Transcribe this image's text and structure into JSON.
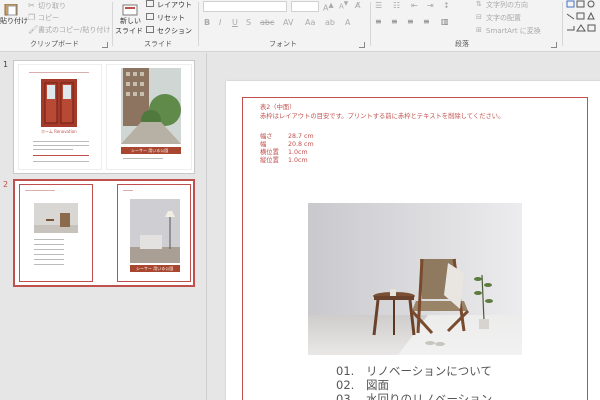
{
  "ribbon": {
    "clipboard": {
      "paste_label": "貼り付け",
      "cut_label": "切り取り",
      "copy_label": "コピー",
      "format_painter_label": "書式のコピー/貼り付け",
      "group_label": "クリップボード"
    },
    "slides": {
      "new_slide_label": "新しい",
      "new_slide_label2": "スライド",
      "layout_label": "レイアウト",
      "reset_label": "リセット",
      "section_label": "セクション",
      "group_label": "スライド"
    },
    "font": {
      "group_label": "フォント"
    },
    "paragraph": {
      "text_direction_label": "文字列の方向",
      "align_text_label": "文字の配置",
      "smartart_label": "SmartArt に変換",
      "group_label": "段落"
    }
  },
  "thumbnails": {
    "slide1_num": "1",
    "slide2_num": "2",
    "slide1_title": "ホーム Renovation",
    "slide1_caption": "シーサー 用いる公園",
    "slide2_caption": "シーサー 用いる公園"
  },
  "slide": {
    "note_title": "表2（中面）",
    "note_text": "赤枠はレイアウトの目安です。プリントする前に赤枠とテキストを削除してください。",
    "specs": [
      {
        "k": "幅さ",
        "v": "28.7 cm"
      },
      {
        "k": "幅",
        "v": "20.8 cm"
      },
      {
        "k": "横位置",
        "v": "1.0cm"
      },
      {
        "k": "縦位置",
        "v": "1.0cm"
      }
    ],
    "toc": [
      {
        "n": "01.",
        "t": "リノベーションについて"
      },
      {
        "n": "02.",
        "t": "図面"
      },
      {
        "n": "03.",
        "t": "水回りのリノベーション"
      }
    ]
  },
  "colors": {
    "accent": "#c0504d",
    "ribbon_bg": "#f3f3f3",
    "panel_bg": "#e6e6e6"
  }
}
